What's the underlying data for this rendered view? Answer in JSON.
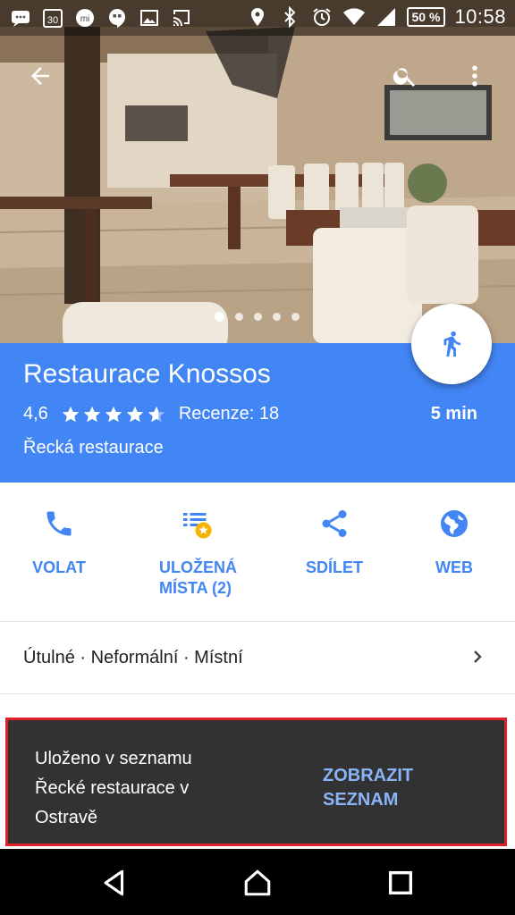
{
  "status_bar": {
    "calendar_day": "30",
    "battery": "50 %",
    "time": "10:58",
    "left_icons": [
      "chat-icon",
      "calendar-icon",
      "mi-icon",
      "hangouts-icon",
      "gallery-icon",
      "cast-icon"
    ],
    "right_icons": [
      "location-icon",
      "bluetooth-icon",
      "alarm-icon",
      "wifi-icon",
      "signal-icon",
      "battery-icon"
    ]
  },
  "hero": {
    "photo_pages": 5,
    "active_page": 1,
    "icons": {
      "back": "arrow-back-icon",
      "search": "search-icon",
      "more": "more-vert-icon"
    }
  },
  "place": {
    "title": "Restaurace Knossos",
    "rating_value": "4,6",
    "rating_stars": 4.6,
    "reviews": "Recenze: 18",
    "travel_time": "5 min",
    "category": "Řecká restaurace",
    "fab_icon": "walking-icon"
  },
  "actions": [
    {
      "label": "VOLAT",
      "icon": "phone-icon"
    },
    {
      "label": "ULOŽENÁ\nMÍSTA (2)",
      "icon": "saved-list-icon"
    },
    {
      "label": "SDÍLET",
      "icon": "share-icon"
    },
    {
      "label": "WEB",
      "icon": "globe-icon"
    }
  ],
  "tags": {
    "text": "Útulné · Neformální · Místní"
  },
  "snackbar": {
    "message": "Uloženo v seznamu Řecké restaurace v Ostravě",
    "action": "ZOBRAZIT\nSEZNAM"
  },
  "nav": {
    "icons": [
      "back-triangle-icon",
      "home-icon",
      "recents-icon"
    ]
  },
  "colors": {
    "primary": "#4285f4",
    "snackbar_bg": "#323232",
    "snackbar_action": "#8ab4f8",
    "highlight_border": "#e2202b",
    "star_badge": "#f4b400"
  }
}
